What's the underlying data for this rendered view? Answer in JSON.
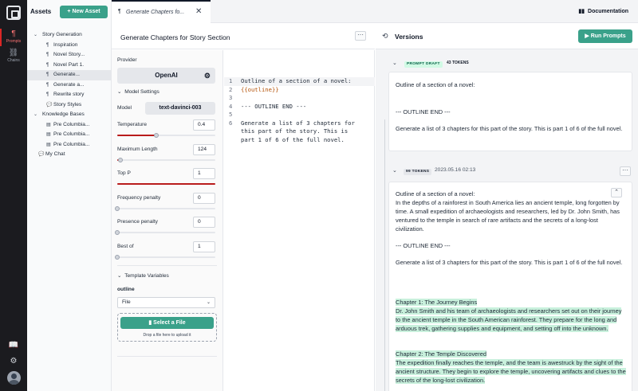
{
  "rail": {
    "items": [
      {
        "label": "Prompts",
        "icon": "prompts-icon",
        "glyph": "¶"
      },
      {
        "label": "Chains",
        "icon": "chains-icon",
        "glyph": "⛓"
      }
    ]
  },
  "assets": {
    "title": "Assets",
    "new_asset_label": "+ New Asset",
    "tree": [
      {
        "label": "Story Generation",
        "depth": 0,
        "kind": "folder",
        "open": true
      },
      {
        "label": "Inspiration",
        "depth": 1,
        "kind": "prompt"
      },
      {
        "label": "Novel Story...",
        "depth": 1,
        "kind": "prompt"
      },
      {
        "label": "Novel Part 1.",
        "depth": 1,
        "kind": "prompt"
      },
      {
        "label": "Generate...",
        "depth": 1,
        "kind": "prompt",
        "selected": true
      },
      {
        "label": "Generate a...",
        "depth": 1,
        "kind": "prompt"
      },
      {
        "label": "Rewrite story",
        "depth": 1,
        "kind": "prompt"
      },
      {
        "label": "Story Styles",
        "depth": 1,
        "kind": "chat"
      },
      {
        "label": "Knowledge Bases",
        "depth": 0,
        "kind": "folder",
        "open": true
      },
      {
        "label": "Pre Columbia...",
        "depth": 1,
        "kind": "kb"
      },
      {
        "label": "Pre Columbia...",
        "depth": 1,
        "kind": "kb"
      },
      {
        "label": "Pre Columbia...",
        "depth": 1,
        "kind": "kb"
      },
      {
        "label": "My Chat",
        "depth": 0,
        "kind": "chat"
      }
    ]
  },
  "tabbar": {
    "tab_label": "Generate Chapters fo...",
    "documentation_label": "Documentation"
  },
  "editor": {
    "title": "Generate Chapters for Story Section"
  },
  "settings": {
    "provider_label": "Provider",
    "provider_value": "OpenAI",
    "model_settings_label": "Model Settings",
    "model_label": "Model",
    "model_value": "text-davinci-003",
    "params": [
      {
        "label": "Temperature",
        "value": "0.4",
        "fraction": 0.4
      },
      {
        "label": "Maximum Length",
        "value": "124",
        "fraction": 0.03
      },
      {
        "label": "Top P",
        "value": "1",
        "fraction": 1.0
      },
      {
        "label": "Frequency penalty",
        "value": "0",
        "fraction": 0
      },
      {
        "label": "Presence penalty",
        "value": "0",
        "fraction": 0
      },
      {
        "label": "Best of",
        "value": "1",
        "fraction": 0
      }
    ],
    "template_vars_label": "Template Variables",
    "var_name": "outline",
    "var_type": "File",
    "select_file_label": "Select a File",
    "drop_hint": "Drop a file here to upload it"
  },
  "code": {
    "lines": [
      {
        "n": "1",
        "text": "Outline of a section of a novel:",
        "kind": "text"
      },
      {
        "n": "2",
        "text": "{{outline}}",
        "kind": "var"
      },
      {
        "n": "3",
        "text": "",
        "kind": "text"
      },
      {
        "n": "4",
        "text": "--- OUTLINE END ---",
        "kind": "text"
      },
      {
        "n": "5",
        "text": "",
        "kind": "text"
      },
      {
        "n": "6",
        "text": "Generate a list of 3 chapters for",
        "kind": "text"
      },
      {
        "n": "",
        "text": "this part of the story. This is",
        "kind": "text"
      },
      {
        "n": "",
        "text": "part 1 of 6 of the full novel.",
        "kind": "text"
      }
    ]
  },
  "versions": {
    "title": "Versions",
    "run_label": "Run Prompts",
    "draft": {
      "badge": "PROMPT DRAFT",
      "tokens": "43 TOKENS",
      "p1": "Outline of a section of a novel:",
      "p2": "--- OUTLINE END ---",
      "p3": "Generate a list of 3 chapters for this part of the story. This is part 1 of 6 of the full novel."
    },
    "v1": {
      "tokens": "99 TOKENS",
      "date": "2023.05.16 02:13",
      "p1a": "Outline of a section of a novel:",
      "p1b": "In the depths of a rainforest in South America lies an ancient temple, long forgotten by time. A small expedition of archaeologists and researchers, led by Dr. John Smith, has ventured to the temple in search of rare artifacts and the secrets of a long-lost civilization.",
      "p2": "--- OUTLINE END ---",
      "p3": "Generate a list of 3 chapters for this part of the story. This is part 1 of 6 of the full novel.",
      "c1_title": "Chapter 1: The Journey Begins",
      "c1_body": "Dr. John Smith and his team of archaeologists and researchers set out on their journey to the ancient temple in the South American rainforest. They prepare for the long and arduous trek, gathering supplies and equipment, and setting off into the unknown.",
      "c2_title": "Chapter 2: The Temple Discovered",
      "c2_body": "The expedition finally reaches the temple, and the team is awestruck by the sight of the ancient structure. They begin to explore the temple, uncovering artifacts and clues to the secrets of the long-lost civilization."
    }
  },
  "colors": {
    "accent": "#3aa18a",
    "rail_bg": "#1b1b1f",
    "slider_fill": "#b91c1c",
    "highlight": "#c8f0dc"
  }
}
